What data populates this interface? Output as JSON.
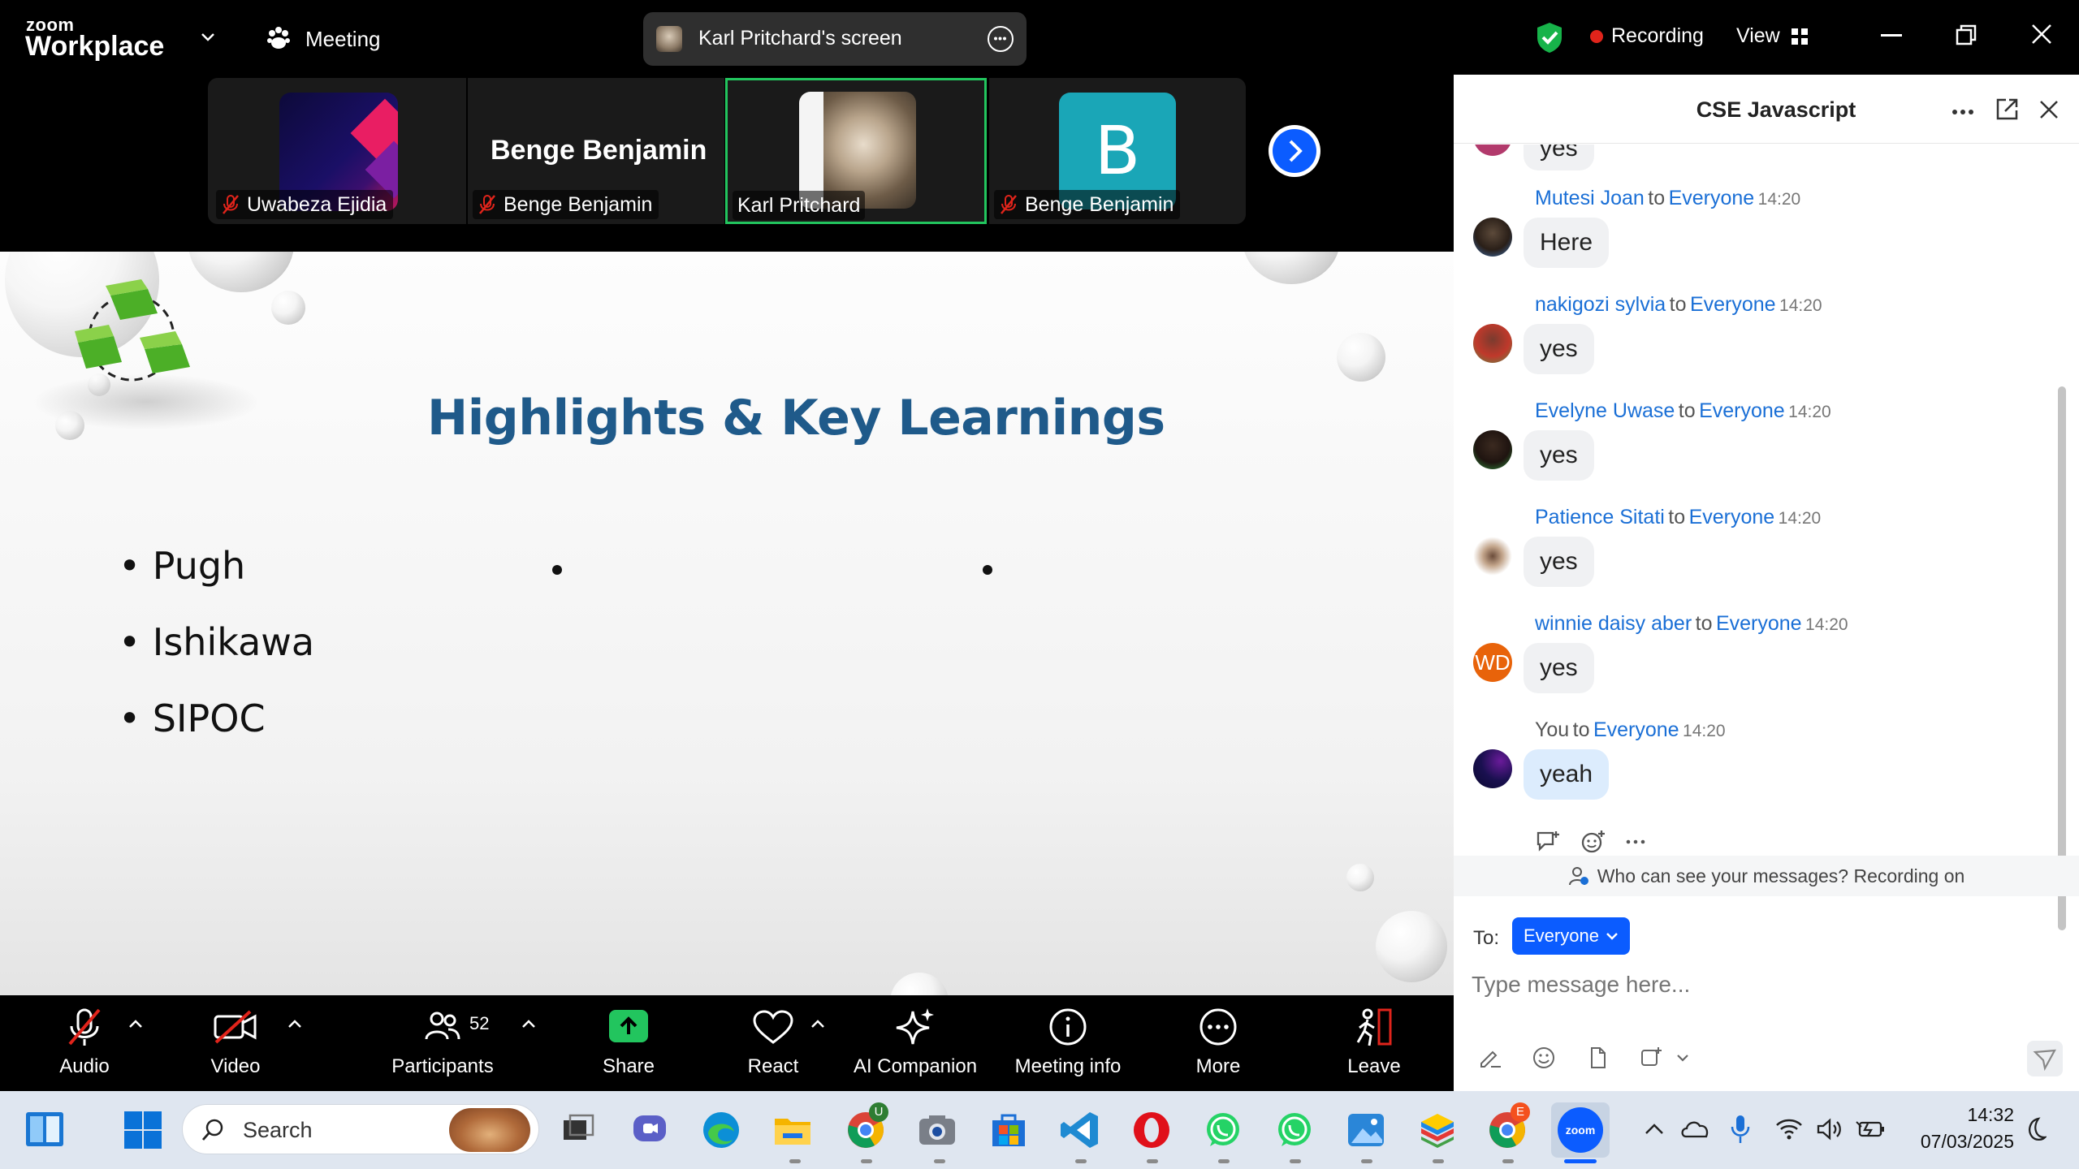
{
  "top_bar": {
    "logo_small": "zoom",
    "logo_big": "Workplace",
    "meeting_label": "Meeting",
    "screen_share_label": "Karl Pritchard's screen",
    "recording_label": "Recording",
    "view_label": "View"
  },
  "thumbnails": [
    {
      "name": "Uwabeza Ejidia",
      "muted": true
    },
    {
      "name": "Benge Benjamin",
      "muted": true,
      "display_name": "Benge Benjamin"
    },
    {
      "name": "Karl Pritchard",
      "muted": false,
      "active": true
    },
    {
      "name": "Benge Benjamin",
      "muted": true,
      "initial": "B"
    }
  ],
  "slide": {
    "title": "Highlights & Key Learnings",
    "bullets": [
      "Pugh",
      "Ishikawa",
      "SIPOC"
    ]
  },
  "toolbar": {
    "audio": "Audio",
    "video": "Video",
    "participants": "Participants",
    "participants_count": "52",
    "share": "Share",
    "react": "React",
    "ai_companion": "AI Companion",
    "meeting_info": "Meeting info",
    "more": "More",
    "leave": "Leave"
  },
  "chat": {
    "title": "CSE Javascript",
    "top_cut_text": "yes",
    "messages": [
      {
        "sender": "Mutesi Joan",
        "to_word": "to",
        "recipient": "Everyone",
        "time": "14:20",
        "text": "Here"
      },
      {
        "sender": "nakigozi sylvia",
        "to_word": "to",
        "recipient": "Everyone",
        "time": "14:20",
        "text": "yes"
      },
      {
        "sender": "Evelyne Uwase",
        "to_word": "to",
        "recipient": "Everyone",
        "time": "14:20",
        "text": "yes"
      },
      {
        "sender": "Patience Sitati",
        "to_word": "to",
        "recipient": "Everyone",
        "time": "14:20",
        "text": "yes"
      },
      {
        "sender": "winnie daisy aber",
        "to_word": "to",
        "recipient": "Everyone",
        "time": "14:20",
        "text": "yes",
        "initials": "WD"
      },
      {
        "sender": "You",
        "to_word": "to",
        "recipient": "Everyone",
        "time": "14:20",
        "text": "yeah"
      }
    ],
    "visibility_notice": "Who can see your messages? Recording on",
    "to_label": "To:",
    "recipient_button": "Everyone",
    "input_placeholder": "Type message here..."
  },
  "taskbar": {
    "search_label": "Search",
    "time": "14:32",
    "date": "07/03/2025",
    "chrome_badge_u": "U",
    "chrome_badge_e": "E",
    "zoom_label": "zoom"
  },
  "colors": {
    "zoom_blue": "#0b5cff",
    "active_green": "#22c55e",
    "link_blue": "#1a6fd6",
    "record_red": "#e0241b",
    "title_blue": "#1f5a8a"
  }
}
